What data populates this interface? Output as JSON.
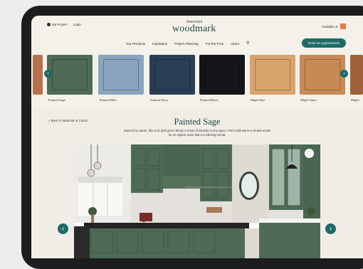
{
  "header": {
    "my_project": "My Project",
    "login": "Login",
    "logo_small": "American",
    "logo_big": "woodmark",
    "available": "Available at",
    "book_button": "Book an Appointment"
  },
  "nav": {
    "items": [
      "Our Products",
      "Inspiration",
      "Project Planning",
      "For the Pros",
      "About"
    ]
  },
  "swatches": [
    {
      "label": "Painted Sage",
      "color": "#4f6b55"
    },
    {
      "label": "Painted Mist",
      "color": "#8aa4bd"
    },
    {
      "label": "Painted Navy",
      "color": "#283f56"
    },
    {
      "label": "Painted Black",
      "color": "#14161a"
    },
    {
      "label": "Maple Rye",
      "color": "#d9a46c"
    },
    {
      "label": "Maple Spice",
      "color": "#c88a55"
    },
    {
      "label": "Maple",
      "color": "#a0623a"
    }
  ],
  "content": {
    "back_link": "« Back to Materials & Colors",
    "title": "Painted Sage",
    "description": "Inspired by nature, this cool, dark green brings a sense of serenity to any space. Pair it with warm or muted woods for an organic oasis that is a calming retreat."
  },
  "colors": {
    "accent": "#1e6b66",
    "brand": "#1f3f3c"
  }
}
